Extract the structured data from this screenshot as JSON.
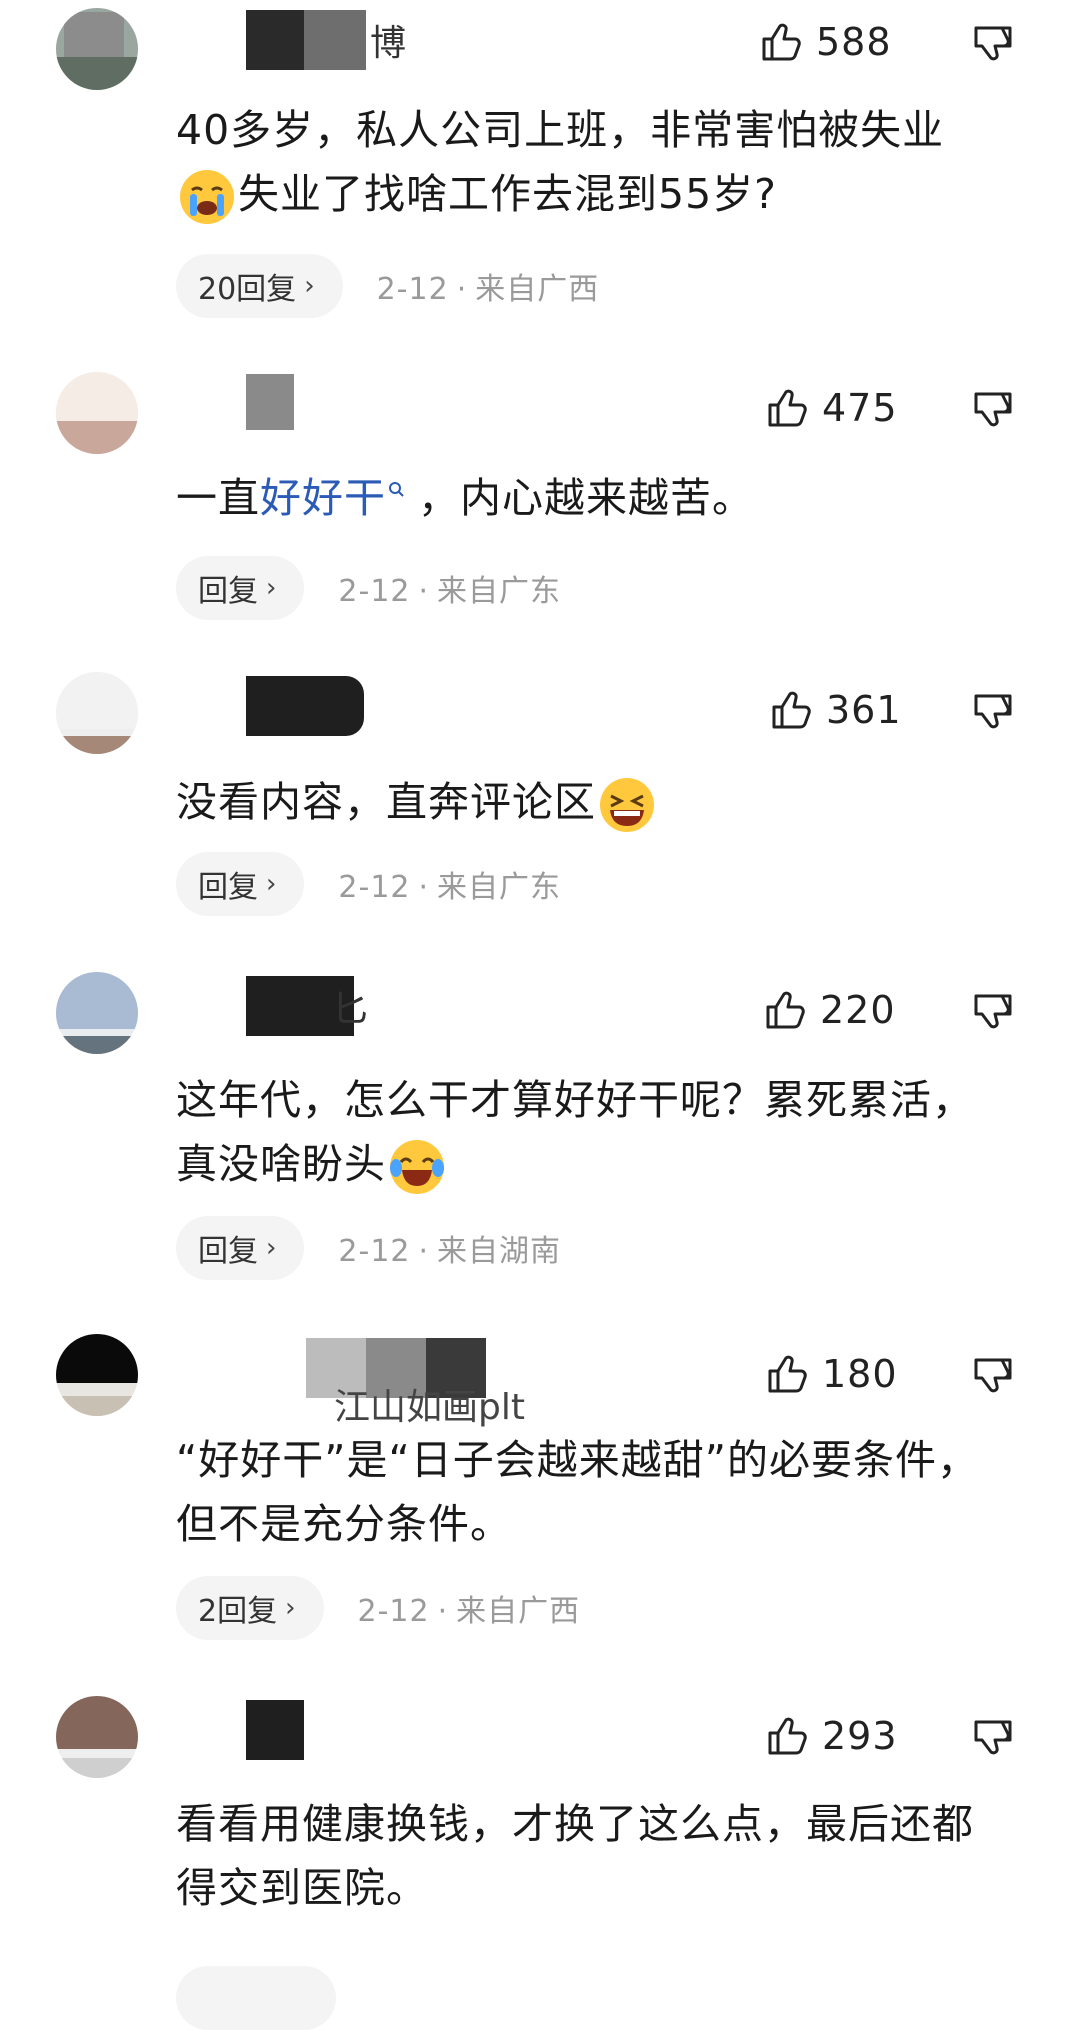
{
  "comments": [
    {
      "username_visible": "博",
      "likes": "588",
      "content_lines": [
        "40多岁，私人公司上班，非常害怕被失业",
        "失业了找啥工作去混到55岁?"
      ],
      "emoji_1": "crying-emoji",
      "reply_label": "20回复",
      "date": "2-12",
      "location": "来自广西"
    },
    {
      "username_visible": "",
      "likes": "475",
      "content_prefix": "一直",
      "content_highlight": "好好干",
      "content_suffix": "，内心越来越苦。",
      "reply_label": "回复",
      "date": "2-12",
      "location": "来自广东"
    },
    {
      "username_visible": "",
      "likes": "361",
      "content_lines": [
        "没看内容，直奔评论区"
      ],
      "emoji_1": "laughing-emoji",
      "reply_label": "回复",
      "date": "2-12",
      "location": "来自广东"
    },
    {
      "username_visible": "匕",
      "likes": "220",
      "content_lines": [
        "这年代，怎么干才算好好干呢？累死累活，",
        "真没啥盼头"
      ],
      "emoji_1": "crying-laughing-emoji",
      "reply_label": "回复",
      "date": "2-12",
      "location": "来自湖南"
    },
    {
      "username_visible": "江山如画plt",
      "likes": "180",
      "content_lines": [
        "“好好干”是“日子会越来越甜”的必要条件，",
        "但不是充分条件。"
      ],
      "reply_label": "2回复",
      "date": "2-12",
      "location": "来自广西"
    },
    {
      "username_visible": "",
      "likes": "293",
      "content_lines": [
        "看看用健康换钱，才换了这么点，最后还都",
        "得交到医院。"
      ]
    }
  ],
  "icons": {
    "like": "thumb-up-icon",
    "dislike": "thumb-down-icon",
    "search": "search-sup-icon",
    "chevron": "chevron-right-icon"
  },
  "colors": {
    "highlight": "#2b5bb7",
    "meta": "#9a9a9a",
    "pill_bg": "#f4f4f4"
  },
  "chevron_glyph": "›",
  "meta_sep": "·"
}
